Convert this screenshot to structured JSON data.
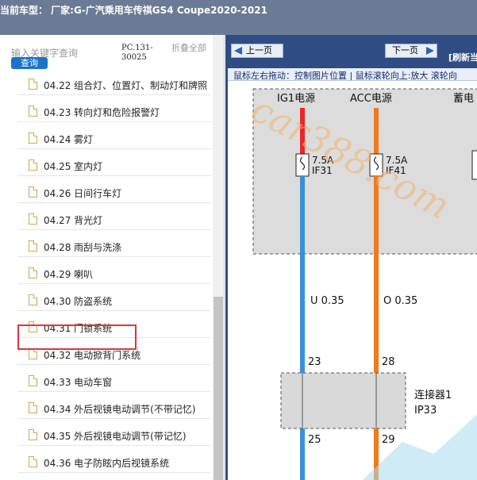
{
  "window": {
    "title": "当前车型：  厂家:G-广汽乘用车传祺GS4 Coupe2020-2021"
  },
  "sidebar": {
    "search_placeholder": "输入关键字查询",
    "query_label": "查询",
    "code": "PC.131-30025",
    "collapse_label": "折叠全部",
    "items": [
      {
        "label": "04.22 组合灯、位置灯、制动灯和牌照"
      },
      {
        "label": "04.23 转向灯和危险报警灯"
      },
      {
        "label": "04.24 雾灯"
      },
      {
        "label": "04.25 室内灯"
      },
      {
        "label": "04.26 日间行车灯"
      },
      {
        "label": "04.27 背光灯"
      },
      {
        "label": "04.28 雨刮与洗涤"
      },
      {
        "label": "04.29 喇叭"
      },
      {
        "label": "04.30 防盗系统",
        "selected": true
      },
      {
        "label": "04.31 门锁系统"
      },
      {
        "label": "04.32 电动掀背门系统"
      },
      {
        "label": "04.33 电动车窗"
      },
      {
        "label": "04.34 外后视镜电动调节(不带记忆)"
      },
      {
        "label": "04.35 外后视镜电动调节(带记忆)"
      },
      {
        "label": "04.36 电子防眩内后视镜系统"
      }
    ]
  },
  "viewer": {
    "prev_label": "上一页",
    "next_label": "下一页",
    "refresh_label": "[刷新当",
    "hint": "鼠标左右拖动：控制图片位置 | 鼠标滚轮向上:放大  滚轮向"
  },
  "diagram": {
    "power_labels": [
      "IG1电源",
      "ACC电源",
      "蓄电"
    ],
    "fuses": [
      {
        "rating": "7.5A",
        "name": "IF31"
      },
      {
        "rating": "7.5A",
        "name": "IF41"
      }
    ],
    "wires": [
      "U 0.35",
      "O 0.35"
    ],
    "pins_top": [
      "23",
      "28"
    ],
    "pins_bottom": [
      "25",
      "29"
    ],
    "connector": {
      "label": "连接器1",
      "code": "IP33"
    },
    "watermark": "car388.com",
    "colors": {
      "wire_red": "#e8262b",
      "wire_blue": "#3a8fd6",
      "wire_orange": "#f07a1a",
      "nav": "#2f4d84",
      "panel_fill": "#dcdcdc"
    }
  }
}
